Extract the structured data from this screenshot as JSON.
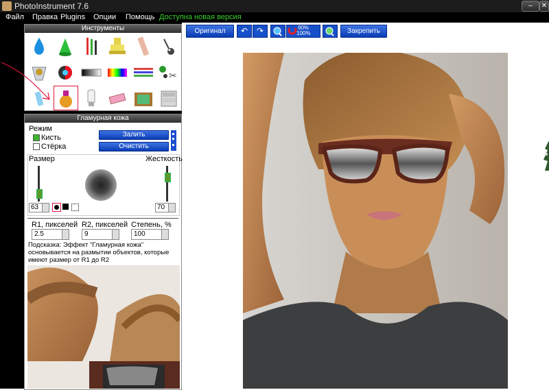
{
  "window": {
    "title": "PhotoInstrument 7.6",
    "minimize": "–",
    "close": "✕"
  },
  "menu": [
    "Файл",
    "Правка",
    "Plugins",
    "Опции",
    "Помощь",
    "Доступна новая версия"
  ],
  "toolbar": {
    "original_label": "Оригинал",
    "fix_label": "Закрепить",
    "zoom_percent_top": "90%",
    "zoom_percent_bottom": "100%"
  },
  "tools_panel": {
    "title": "Инструменты"
  },
  "glamour_panel": {
    "title": "Гламурная кожа",
    "mode_label": "Режим",
    "brush_label": "Кисть",
    "eraser_label": "Стёрка",
    "fill_label": "Залить",
    "clear_label": "Очистить",
    "size_label": "Размер",
    "hardness_label": "Жесткость",
    "size_value": "63",
    "hardness_value": "70",
    "r1_label": "R1, пикселей",
    "r2_label": "R2, пикселей",
    "degree_label": "Степень, %",
    "r1_value": "2.5",
    "r2_value": "9",
    "degree_value": "100",
    "hint": "Подсказка: Эффект \"Гламурная кожа\" основывается на размытии объектов, которые имеют размер от R1 до R2"
  },
  "colors": {
    "accent_blue": "#1a4fd0",
    "menu_new_version": "#39d12d",
    "selection_red": "#e2143c"
  }
}
